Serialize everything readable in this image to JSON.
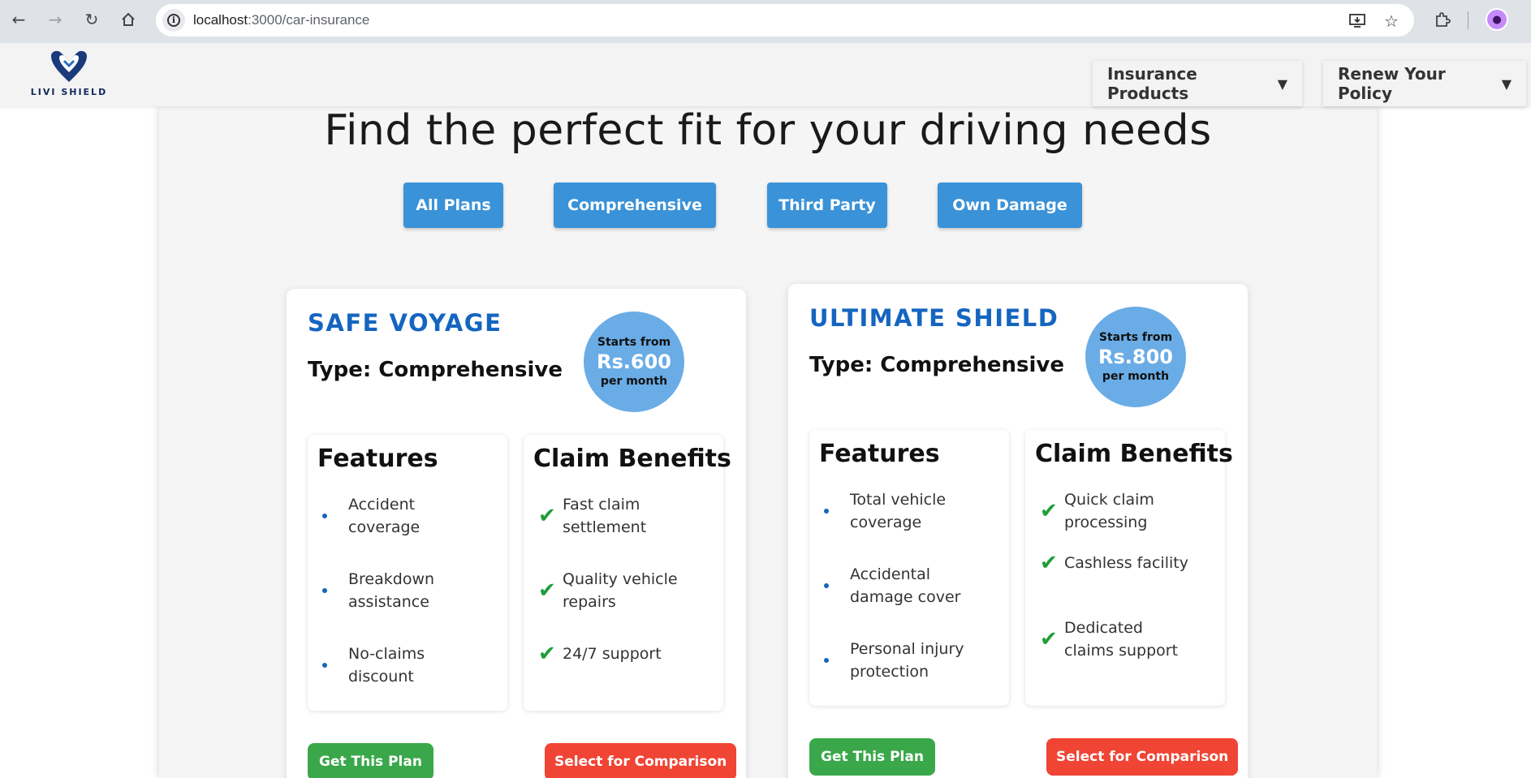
{
  "browser": {
    "url_host": "localhost",
    "url_rest": ":3000/car-insurance"
  },
  "header": {
    "brand": "LIVI SHIELD",
    "menu": [
      {
        "label": "Insurance Products",
        "caret": "▼"
      },
      {
        "label": "Renew Your Policy",
        "caret": "▼"
      }
    ]
  },
  "main": {
    "title": "Find the perfect fit for your driving needs",
    "filters": [
      "All Plans",
      "Comprehensive",
      "Third Party",
      "Own Damage"
    ]
  },
  "plans": [
    {
      "name": "SAFE VOYAGE",
      "type": "Type: Comprehensive",
      "price_prefix": "Starts from",
      "price": "Rs.600",
      "price_suffix": "per month",
      "features_title": "Features",
      "features": [
        "Accident coverage",
        "Breakdown assistance",
        "No-claims discount"
      ],
      "benefits_title": "Claim Benefits",
      "benefits": [
        "Fast claim settlement",
        "Quality vehicle repairs",
        "24/7 support"
      ],
      "get_label": "Get This Plan",
      "compare_label": "Select for Comparison"
    },
    {
      "name": "ULTIMATE SHIELD",
      "type": "Type: Comprehensive",
      "price_prefix": "Starts from",
      "price": "Rs.800",
      "price_suffix": "per month",
      "features_title": "Features",
      "features": [
        "Total vehicle coverage",
        "Accidental damage cover",
        "Personal injury protection"
      ],
      "benefits_title": "Claim Benefits",
      "benefits": [
        "Quick claim processing",
        "Cashless facility",
        "Dedicated claims support"
      ],
      "get_label": "Get This Plan",
      "compare_label": "Select for Comparison"
    }
  ],
  "colors": {
    "primary_blue": "#3a92d8",
    "plan_name_blue": "#1565c0",
    "price_bubble": "#6aace6",
    "check_green": "#1e9e3a",
    "get_button_green": "#3aa84a",
    "compare_button_red": "#f04434"
  }
}
